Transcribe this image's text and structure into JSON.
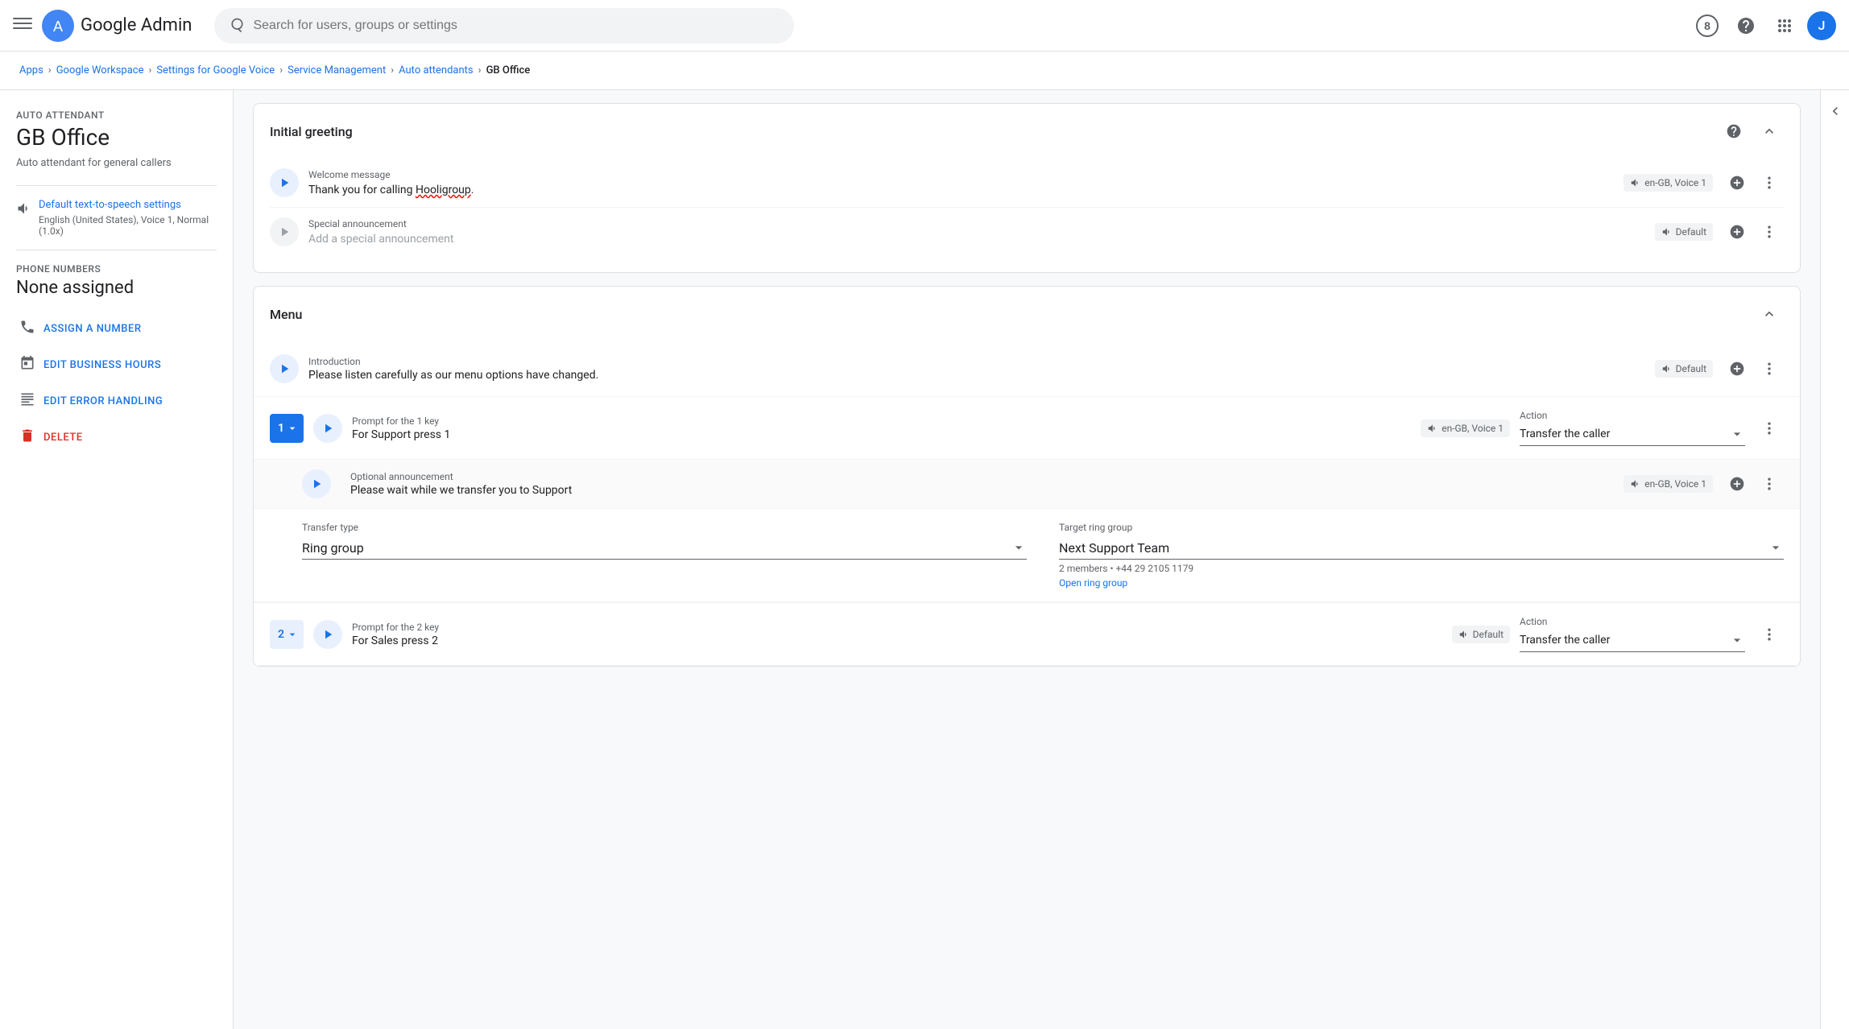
{
  "nav": {
    "menu_label": "☰",
    "logo_prefix": "Google ",
    "logo_suffix": "Admin",
    "search_placeholder": "Search for users, groups or settings",
    "help_badge": "?",
    "avatar_letter": "J"
  },
  "breadcrumb": {
    "items": [
      {
        "label": "Apps",
        "link": true
      },
      {
        "label": "Google Workspace",
        "link": true
      },
      {
        "label": "Settings for Google Voice",
        "link": true
      },
      {
        "label": "Service Management",
        "link": true
      },
      {
        "label": "Auto attendants",
        "link": true
      },
      {
        "label": "GB Office",
        "link": false
      }
    ]
  },
  "sidebar": {
    "auto_attendant_label": "Auto attendant",
    "title": "GB Office",
    "subtitle": "Auto attendant for general callers",
    "tts_label": "Default text-to-speech settings",
    "tts_detail": "English (United States), Voice 1, Normal (1.0x)",
    "phone_numbers_label": "Phone numbers",
    "phone_numbers_value": "None assigned",
    "actions": [
      {
        "id": "assign",
        "icon": "📞",
        "label": "ASSIGN A NUMBER"
      },
      {
        "id": "hours",
        "icon": "📅",
        "label": "EDIT BUSINESS HOURS"
      },
      {
        "id": "error",
        "icon": "⚠",
        "label": "EDIT ERROR HANDLING"
      },
      {
        "id": "delete",
        "icon": "🗑",
        "label": "DELETE",
        "variant": "delete"
      }
    ]
  },
  "initial_greeting": {
    "section_title": "Initial greeting",
    "welcome_message_label": "Welcome message",
    "welcome_text": "Thank you for calling Hooligroup.",
    "welcome_voice": "en-GB, Voice 1",
    "special_announcement_label": "Special announcement",
    "special_placeholder": "Add a special announcement",
    "special_voice": "Default"
  },
  "menu": {
    "section_title": "Menu",
    "intro_label": "Introduction",
    "intro_text": "Please listen carefully as our menu options have changed.",
    "intro_voice": "Default",
    "key1": {
      "key_label": "1",
      "prompt_label": "Prompt for the 1 key",
      "prompt_text": "For Support press 1",
      "prompt_voice": "en-GB, Voice 1",
      "action_label": "Action",
      "action_text": "Transfer the caller",
      "optional_label": "Optional announcement",
      "optional_text": "Please wait while we transfer you to Support",
      "optional_voice": "en-GB, Voice 1",
      "transfer_type_label": "Transfer type",
      "transfer_type": "Ring group",
      "target_group_label": "Target ring group",
      "target_group": "Next Support Team",
      "target_sub": "2 members • +44 29 2105 1179",
      "open_link": "Open ring group"
    },
    "key2": {
      "key_label": "2",
      "prompt_label": "Prompt for the 2 key",
      "prompt_text": "For Sales press 2",
      "prompt_voice": "Default",
      "action_label": "Action",
      "action_text": "Transfer the caller"
    }
  },
  "icons": {
    "play": "▶",
    "chevron_up": "∧",
    "chevron_down": "∨",
    "more_vert": "⋮",
    "add_circle": "+",
    "sound": "🔊",
    "dropdown_arrow": "▾"
  }
}
